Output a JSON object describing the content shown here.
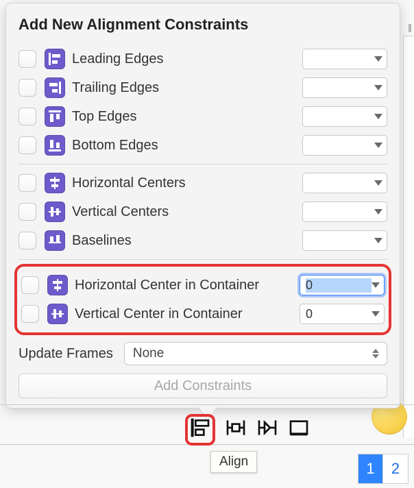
{
  "title": "Add New Alignment Constraints",
  "group1": [
    {
      "label": "Leading Edges",
      "value": ""
    },
    {
      "label": "Trailing Edges",
      "value": ""
    },
    {
      "label": "Top Edges",
      "value": ""
    },
    {
      "label": "Bottom Edges",
      "value": ""
    }
  ],
  "group2": [
    {
      "label": "Horizontal Centers",
      "value": ""
    },
    {
      "label": "Vertical Centers",
      "value": ""
    },
    {
      "label": "Baselines",
      "value": ""
    }
  ],
  "group3": [
    {
      "label": "Horizontal Center in Container",
      "value": "0",
      "highlight": true
    },
    {
      "label": "Vertical Center in Container",
      "value": "0"
    }
  ],
  "updateFrames": {
    "label": "Update Frames",
    "value": "None"
  },
  "addButton": "Add Constraints",
  "tooltip": "Align",
  "pager": [
    "1",
    "2"
  ],
  "pagerActive": 0,
  "icons": {
    "align": "align-icon",
    "pin": "pin-icon",
    "resolve": "resolve-icon",
    "resize": "resize-icon"
  }
}
